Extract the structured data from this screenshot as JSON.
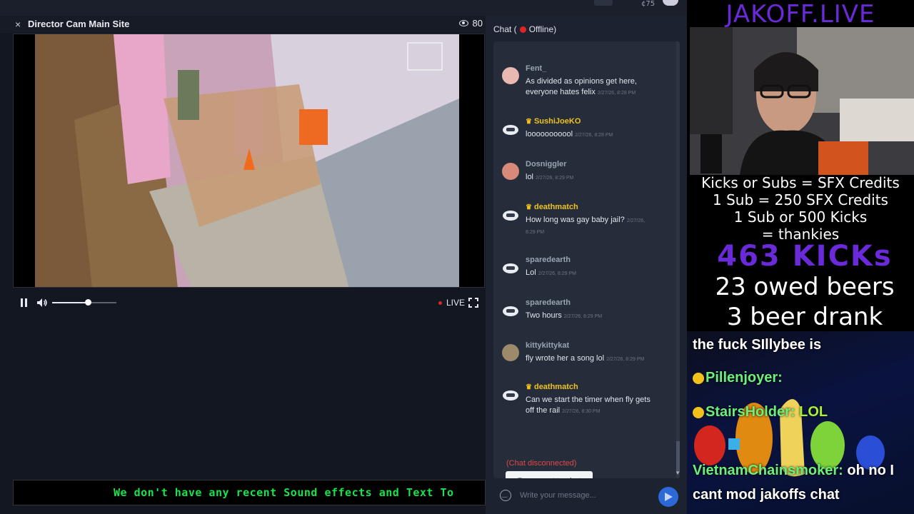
{
  "topbar": {
    "coin_value": "¢75"
  },
  "player": {
    "title": "Director Cam Main Site",
    "viewers": "80",
    "live_label": "LIVE",
    "volume_level": 0.55
  },
  "ticker_text": "We don't have any recent Sound effects and Text To",
  "chat": {
    "header_prefix": "Chat (",
    "status": "Offline)",
    "messages": [
      {
        "user": "Fent_",
        "vip": false,
        "text": "As divided as opinions get here, everyone hates felix",
        "time": "2/27/26, 8:28 PM"
      },
      {
        "user": "SushiJoeKO",
        "vip": true,
        "text": "looooooooool",
        "time": "2/27/26, 8:28 PM"
      },
      {
        "user": "Dosniggler",
        "vip": false,
        "text": "lol",
        "time": "2/27/26, 8:29 PM"
      },
      {
        "user": "deathmatch",
        "vip": true,
        "text": "How long was gay baby jail?",
        "time": "2/27/26, 8:29 PM"
      },
      {
        "user": "sparedearth",
        "vip": false,
        "text": "Lol",
        "time": "2/27/26, 8:29 PM"
      },
      {
        "user": "sparedearth",
        "vip": false,
        "text": "Two hours",
        "time": "2/27/26, 8:29 PM"
      },
      {
        "user": "kittykittykat",
        "vip": false,
        "text": "fly wrote her a song lol",
        "time": "2/27/26, 8:29 PM"
      },
      {
        "user": "deathmatch",
        "vip": true,
        "text": "Can we start the timer when fly gets off the rail",
        "time": "2/27/26, 8:30 PM"
      }
    ],
    "disconnected_text": "(Chat disconnected)",
    "reconnect_label": "Reconnect to chat",
    "input_placeholder": "Write your message..."
  },
  "overlay": {
    "title": "JAKOFF.LIVE",
    "rules": [
      "Kicks or Subs = SFX Credits",
      "1 Sub = 250 SFX Credits",
      "1 Sub or 500 Kicks",
      "= thankies"
    ],
    "kicks": "463 KICKs",
    "owed_beers": "23 owed beers",
    "beers_drank": "3 beer drank",
    "stream_chat": [
      {
        "user": "",
        "text": "the fuck SIllybee is"
      },
      {
        "user": "Pillenjoyer:",
        "text": ""
      },
      {
        "user": "StairsHolder:",
        "text": "LOL"
      },
      {
        "user": "VietnamChainsmoker:",
        "text": "oh no I"
      },
      {
        "user": "",
        "text": "cant mod jakoffs chat"
      }
    ]
  },
  "colors": {
    "accent_purple": "#6a2ad9",
    "live_red": "#e02424",
    "ticker_green": "#19e34a",
    "vip_gold": "#f1c21b",
    "send_blue": "#2c68d6"
  }
}
